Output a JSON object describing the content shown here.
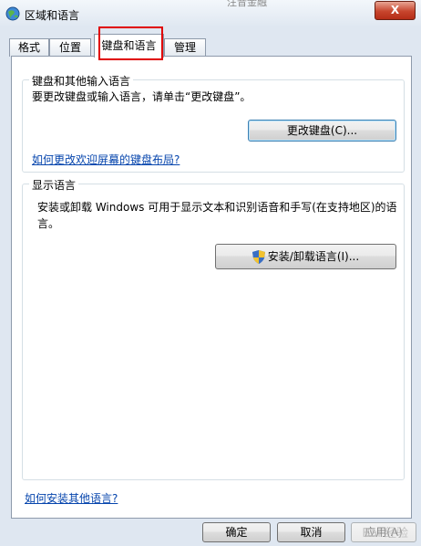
{
  "window": {
    "title": "区域和语言",
    "ghost_text": "注音金融",
    "close_label": "X"
  },
  "tabs": [
    {
      "label": "格式"
    },
    {
      "label": "位置"
    },
    {
      "label": "键盘和语言"
    },
    {
      "label": "管理"
    }
  ],
  "keyboards": {
    "title": "键盘和其他输入语言",
    "description": "要更改键盘或输入语言，请单击“更改键盘”。",
    "change_button": "更改键盘(C)...",
    "welcome_link": "如何更改欢迎屏幕的键盘布局?"
  },
  "display_language": {
    "title": "显示语言",
    "description": "安装或卸载 Windows 可用于显示文本和识别语音和手写(在支持地区)的语言。",
    "install_button": "安装/卸载语言(I)..."
  },
  "footer_link": "如何安装其他语言?",
  "dialog_buttons": {
    "ok": "确定",
    "cancel": "取消",
    "apply": "应用(A)"
  },
  "watermark": "Bai 经验"
}
